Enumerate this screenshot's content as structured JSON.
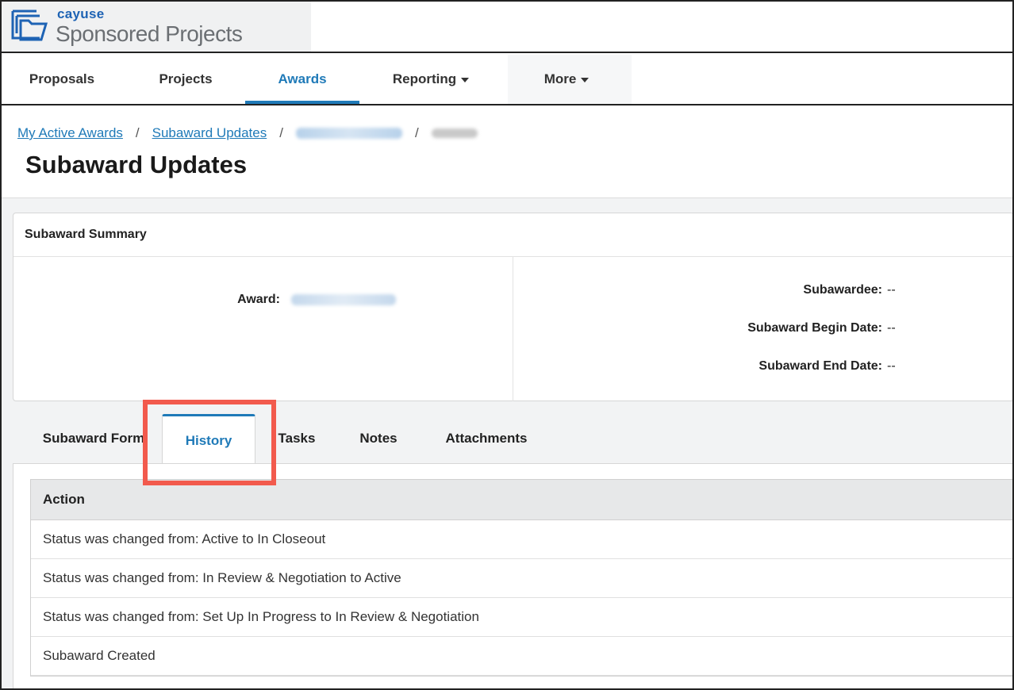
{
  "brand": {
    "small": "cayuse",
    "large": "Sponsored Projects"
  },
  "nav": {
    "items": [
      {
        "label": "Proposals"
      },
      {
        "label": "Projects"
      },
      {
        "label": "Awards",
        "active": true
      },
      {
        "label": "Reporting",
        "dropdown": true
      },
      {
        "label": "More",
        "dropdown": true
      }
    ]
  },
  "breadcrumb": {
    "items": [
      {
        "label": "My Active Awards"
      },
      {
        "label": "Subaward Updates"
      }
    ],
    "separator": "/"
  },
  "page": {
    "title": "Subaward Updates"
  },
  "summary": {
    "title": "Subaward Summary",
    "award_label": "Award:",
    "subawardee_label": "Subawardee:",
    "subawardee_value": "--",
    "begin_label": "Subaward Begin Date:",
    "begin_value": "--",
    "end_label": "Subaward End Date:",
    "end_value": "--"
  },
  "tabs": [
    {
      "label": "Subaward Form"
    },
    {
      "label": "History",
      "active": true
    },
    {
      "label": "Tasks"
    },
    {
      "label": "Notes"
    },
    {
      "label": "Attachments"
    }
  ],
  "history": {
    "column": "Action",
    "rows": [
      "Status was changed from: Active to In Closeout",
      "Status was changed from: In Review & Negotiation to Active",
      "Status was changed from: Set Up In Progress to In Review & Negotiation",
      "Subaward Created"
    ]
  },
  "colors": {
    "accent": "#1f7ab8",
    "brand": "#1e63b4",
    "highlight": "#f25a4d"
  }
}
